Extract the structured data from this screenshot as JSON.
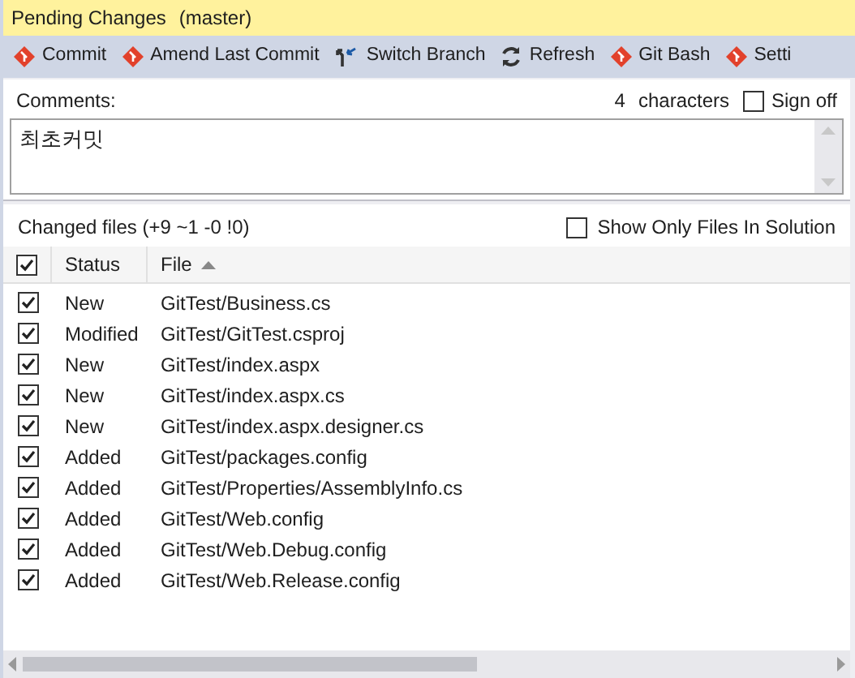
{
  "window": {
    "title": "Pending Changes",
    "branch": "(master)"
  },
  "toolbar": [
    {
      "label": "Commit",
      "kind": "git"
    },
    {
      "label": "Amend Last Commit",
      "kind": "git"
    },
    {
      "label": "Switch Branch",
      "kind": "switch"
    },
    {
      "label": "Refresh",
      "kind": "refresh"
    },
    {
      "label": "Git Bash",
      "kind": "git"
    },
    {
      "label": "Setti",
      "kind": "git"
    }
  ],
  "comments": {
    "label": "Comments:",
    "count": "4",
    "count_label": "characters",
    "sign_off": {
      "label": "Sign off",
      "checked": false
    },
    "value": "최초커밋"
  },
  "changes": {
    "title": "Changed files (+9 ~1 -0 !0)",
    "show_only": {
      "label": "Show Only Files In Solution",
      "checked": false
    },
    "header": {
      "checked": true,
      "columns": [
        "Status",
        "File"
      ]
    },
    "rows": [
      {
        "checked": true,
        "status": "New",
        "file": "GitTest/Business.cs"
      },
      {
        "checked": true,
        "status": "Modified",
        "file": "GitTest/GitTest.csproj"
      },
      {
        "checked": true,
        "status": "New",
        "file": "GitTest/index.aspx"
      },
      {
        "checked": true,
        "status": "New",
        "file": "GitTest/index.aspx.cs"
      },
      {
        "checked": true,
        "status": "New",
        "file": "GitTest/index.aspx.designer.cs"
      },
      {
        "checked": true,
        "status": "Added",
        "file": "GitTest/packages.config"
      },
      {
        "checked": true,
        "status": "Added",
        "file": "GitTest/Properties/AssemblyInfo.cs"
      },
      {
        "checked": true,
        "status": "Added",
        "file": "GitTest/Web.config"
      },
      {
        "checked": true,
        "status": "Added",
        "file": "GitTest/Web.Debug.config"
      },
      {
        "checked": true,
        "status": "Added",
        "file": "GitTest/Web.Release.config"
      }
    ]
  }
}
